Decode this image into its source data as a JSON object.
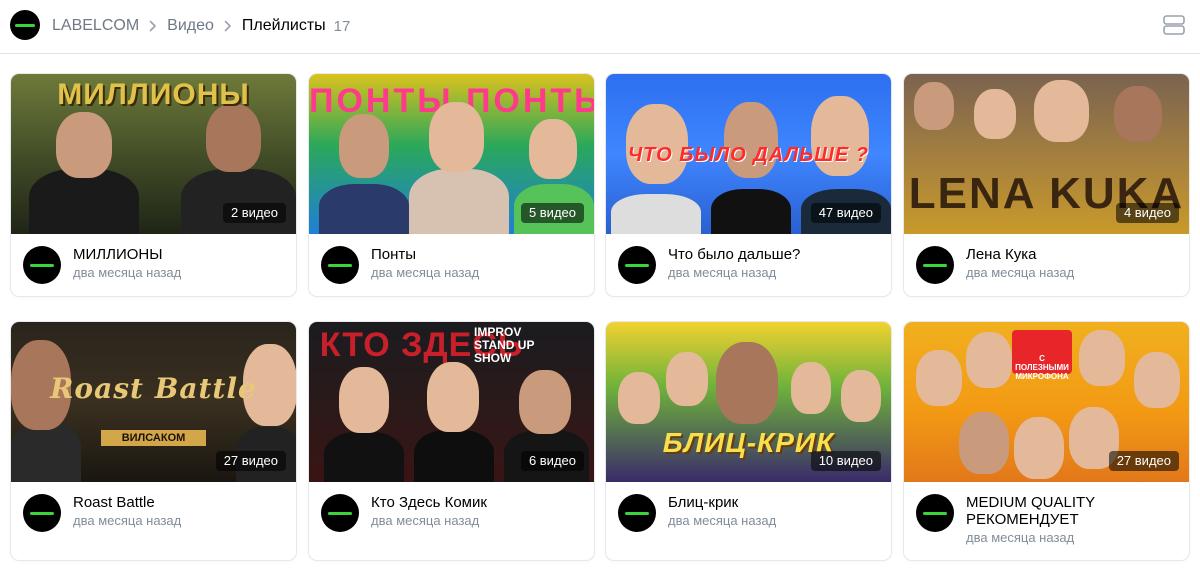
{
  "header": {
    "channel": "LABELCOM",
    "breadcrumb": [
      "Видео",
      "Плейлисты"
    ],
    "count": "17"
  },
  "playlists": [
    {
      "title": "МИЛЛИОНЫ",
      "date": "два месяца назад",
      "videos": "2 видео",
      "thumb_text": "МИЛЛИОНЫ",
      "accent": "#d6b23a"
    },
    {
      "title": "Понты",
      "date": "два месяца назад",
      "videos": "5 видео",
      "thumb_text": "ПОНТЫ ПОНТЫ",
      "accent": "#2aa85a"
    },
    {
      "title": "Что было дальше?",
      "date": "два месяца назад",
      "videos": "47 видео",
      "thumb_text": "ЧТО БЫЛО ДАЛЬШЕ ?",
      "accent": "#e02020"
    },
    {
      "title": "Лена Кука",
      "date": "два месяца назад",
      "videos": "4 видео",
      "thumb_text": "LENA KUKA",
      "accent": "#c7861b"
    },
    {
      "title": "Roast Battle",
      "date": "два месяца назад",
      "videos": "27 видео",
      "thumb_text": "Roast Battle",
      "thumb_sub": "ВИЛСАКОМ",
      "accent": "#d9b05a"
    },
    {
      "title": "Кто Здесь Комик",
      "date": "два месяца назад",
      "videos": "6 видео",
      "thumb_text": "КТО ЗДЕСЬ",
      "thumb_sub": "IMPROV STAND UP SHOW",
      "accent": "#c8202a"
    },
    {
      "title": "Блиц-крик",
      "date": "два месяца назад",
      "videos": "10 видео",
      "thumb_text": "БЛИЦ-КРИК",
      "accent": "#f2d230"
    },
    {
      "title": "MEDIUM QUALITY РЕКОМЕНДУЕТ",
      "date": "два месяца назад",
      "videos": "27 видео",
      "thumb_text": "С ПОЛЕЗНЫМИ МИКРОФОНА",
      "accent": "#e8262a"
    }
  ],
  "colors": {
    "link_gray": "#6f7985",
    "date_gray": "#818c99",
    "badge_bg": "rgba(0,0,0,0.55)",
    "divider": "#e1e3e6"
  },
  "icons": {
    "separator": "chevron-right-icon",
    "view_toggle": "list-view-icon"
  }
}
